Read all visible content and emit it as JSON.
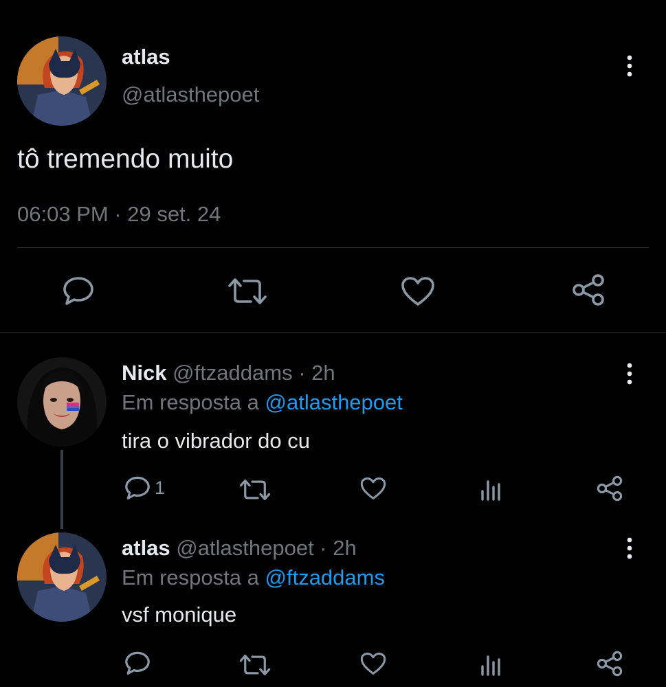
{
  "main_tweet": {
    "author_name": "atlas",
    "author_handle": "@atlasthepoet",
    "text": "tô tremendo muito",
    "timestamp": "06:03 PM · 29 set. 24"
  },
  "replies": [
    {
      "author_name": "Nick",
      "meta": "@ftzaddams · 2h",
      "reply_prefix": "Em resposta a",
      "reply_to": "@atlasthepoet",
      "text": "tira o vibrador do cu",
      "reply_count": "1"
    },
    {
      "author_name": "atlas",
      "meta": "@atlasthepoet · 2h",
      "reply_prefix": "Em resposta a",
      "reply_to": "@ftzaddams",
      "text": "vsf monique",
      "reply_count": ""
    }
  ],
  "icons": [
    "more-vertical-icon",
    "reply-icon",
    "retweet-icon",
    "like-icon",
    "share-icon",
    "analytics-icon"
  ],
  "colors": {
    "background": "#000000",
    "text": "#e7e9ea",
    "muted": "#71767b",
    "link": "#1d9bf0",
    "divider": "#2f3336"
  }
}
